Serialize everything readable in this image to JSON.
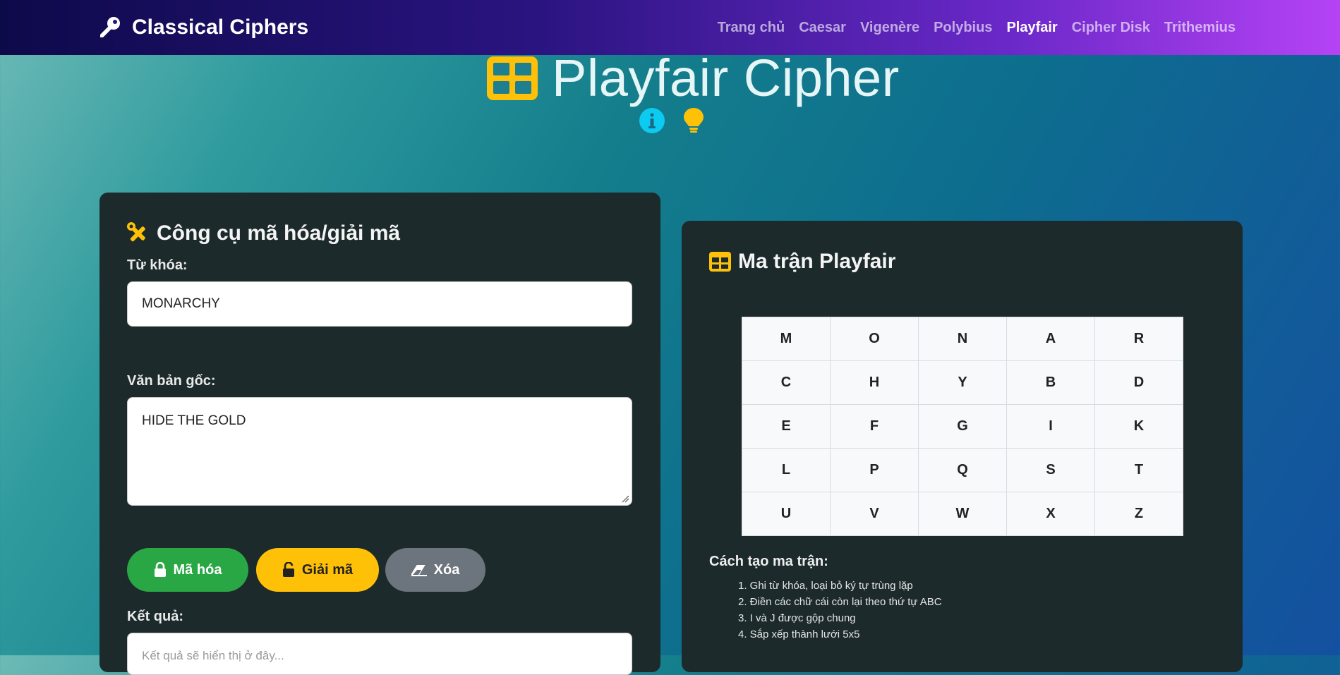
{
  "brand": {
    "name": "Classical Ciphers",
    "icon": "key-icon"
  },
  "nav": {
    "links": [
      "Trang chủ",
      "Caesar",
      "Vigenère",
      "Polybius",
      "Playfair",
      "Cipher Disk",
      "Trithemius"
    ],
    "active": "Playfair"
  },
  "hero": {
    "title": "Playfair Cipher",
    "title_icon": "table-icon",
    "icons": [
      "info-icon",
      "lightbulb-icon"
    ]
  },
  "tool": {
    "title": "Công cụ mã hóa/giải mã",
    "icon": "tools-icon",
    "keyword_label": "Từ khóa:",
    "keyword_value": "MONARCHY",
    "plaintext_label": "Văn bản gốc:",
    "plaintext_value": "HIDE THE GOLD",
    "buttons": {
      "encrypt": "Mã hóa",
      "decrypt": "Giải mã",
      "clear": "Xóa"
    },
    "result_label": "Kết quả:",
    "result_placeholder": "Kết quả sẽ hiển thị ở đây..."
  },
  "matrix": {
    "title": "Ma trận Playfair",
    "icon": "table-icon",
    "rows": [
      [
        "M",
        "O",
        "N",
        "A",
        "R"
      ],
      [
        "C",
        "H",
        "Y",
        "B",
        "D"
      ],
      [
        "E",
        "F",
        "G",
        "I",
        "K"
      ],
      [
        "L",
        "P",
        "Q",
        "S",
        "T"
      ],
      [
        "U",
        "V",
        "W",
        "X",
        "Z"
      ]
    ],
    "steps_title": "Cách tạo ma trận:",
    "steps": [
      "1. Ghi từ khóa, loại bỏ ký tự trùng lặp",
      "2. Điền các chữ cái còn lại theo thứ tự ABC",
      "3. I và J được gộp chung",
      "4. Sắp xếp thành lưới 5x5"
    ]
  },
  "colors": {
    "accent_yellow": "#ffc107",
    "info_cyan": "#0dcaf0",
    "success_green": "#29a745",
    "secondary_gray": "#6c757d",
    "card_bg": "#1c2a2c"
  }
}
